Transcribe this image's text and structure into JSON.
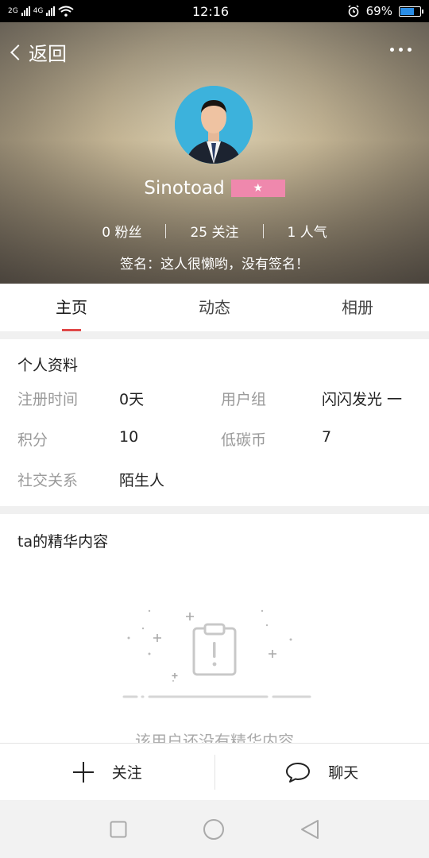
{
  "status_bar": {
    "network_left": "2G",
    "network_right": "4G",
    "time": "12:16",
    "battery_percent": "69%",
    "battery_level": 0.69
  },
  "header": {
    "back_label": "返回",
    "username": "Sinotoad",
    "stats": {
      "fans": "0 粉丝",
      "following": "25 关注",
      "popularity": "1 人气"
    },
    "signature": "签名：这人很懒哟，没有签名！"
  },
  "tabs": [
    {
      "label": "主页",
      "active": true
    },
    {
      "label": "动态",
      "active": false
    },
    {
      "label": "相册",
      "active": false
    }
  ],
  "profile": {
    "title": "个人资料",
    "fields": {
      "register_time": {
        "label": "注册时间",
        "value": "0天"
      },
      "user_group": {
        "label": "用户组",
        "value": "闪闪发光 一"
      },
      "points": {
        "label": "积分",
        "value": "10"
      },
      "coins": {
        "label": "低碳币",
        "value": "7"
      },
      "relation": {
        "label": "社交关系",
        "value": "陌生人"
      }
    }
  },
  "highlights": {
    "title": "ta的精华内容",
    "empty_text": "该用户还没有精华内容"
  },
  "actions": {
    "follow_label": "关注",
    "chat_label": "聊天"
  },
  "colors": {
    "accent": "#e04848",
    "badge": "#ef88ad",
    "battery": "#2a8ee8"
  }
}
